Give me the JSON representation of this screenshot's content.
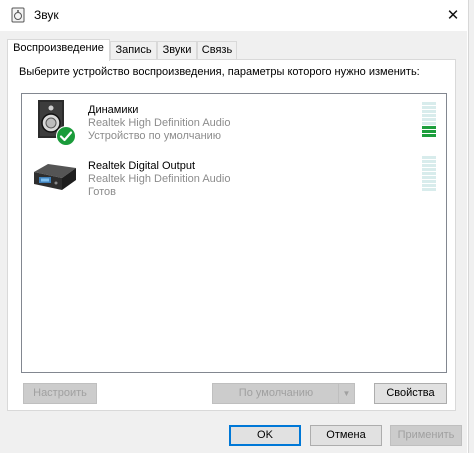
{
  "window": {
    "title": "Звук",
    "close_glyph": "✕"
  },
  "tabs": [
    {
      "label": "Воспроизведение",
      "active": true
    },
    {
      "label": "Запись",
      "active": false
    },
    {
      "label": "Звуки",
      "active": false
    },
    {
      "label": "Связь",
      "active": false
    }
  ],
  "instruction": "Выберите устройство воспроизведения, параметры которого нужно изменить:",
  "devices": [
    {
      "name": "Динамики",
      "driver": "Realtek High Definition Audio",
      "status": "Устройство по умолчанию",
      "icon": "speaker-icon",
      "default_badge": "check-icon",
      "level_segments_on": 3,
      "level_segments_total": 9
    },
    {
      "name": "Realtek Digital Output",
      "driver": "Realtek High Definition Audio",
      "status": "Готов",
      "icon": "digital-output-icon",
      "level_segments_on": 0,
      "level_segments_total": 9
    }
  ],
  "buttons": {
    "configure": "Настроить",
    "set_default": "По умолчанию",
    "properties": "Свойства",
    "ok": "OK",
    "cancel": "Отмена",
    "apply": "Применить"
  },
  "colors": {
    "accent": "#0078d7",
    "meter_on": "#1c9e3c",
    "meter_off": "#d8ecec",
    "check_badge": "#1a9b3a"
  }
}
